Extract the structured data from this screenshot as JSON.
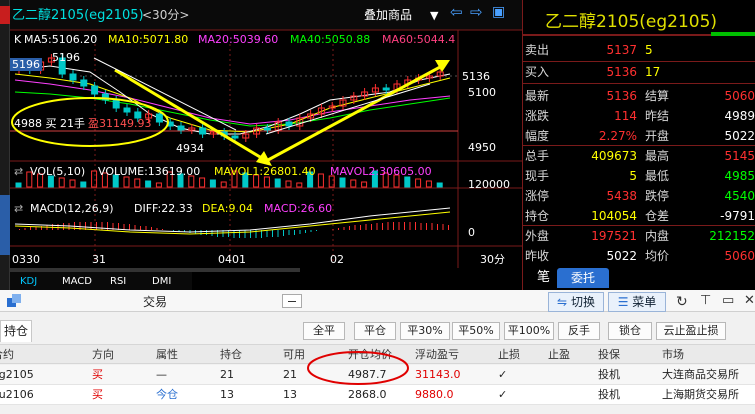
{
  "chart": {
    "title": "乙二醇2105(eg2105)",
    "period": "<30分>",
    "overlay_label": "叠加商品",
    "ma_line": {
      "k": "K",
      "ma5": "MA5:5106.20",
      "ma10": "MA10:5071.80",
      "ma20": "MA20:5039.60",
      "ma40": "MA40:5050.88",
      "ma60": "MA60:5044.4"
    },
    "price_left_label": "5196",
    "peak_label": "5196",
    "low_label": "4934",
    "annotation": "4988 买 21手",
    "annotation_profit": "盈31149.93",
    "price_axis": [
      "5136",
      "5100",
      "4950"
    ],
    "volume_line": {
      "name": "VOL(5,10)",
      "volume": "VOLUME:13619.00",
      "mavol1": "MAVOL1:26801.40",
      "mavol2": "MAVOL2:30605.00"
    },
    "volume_axis": "120000",
    "macd_line": {
      "name": "MACD(12,26,9)",
      "diff": "DIFF:22.33",
      "dea": "DEA:9.04",
      "macd": "MACD:26.60"
    },
    "macd_axis": "0",
    "time_axis": [
      "0330",
      "31",
      "0401",
      "02",
      "30分"
    ],
    "indicator_tabs": [
      "KDJ",
      "MACD",
      "RSI",
      "DMI"
    ]
  },
  "quote": {
    "title": "乙二醇2105(eg2105)",
    "ask": {
      "label": "卖出",
      "price": "5137",
      "vol": "5"
    },
    "bid": {
      "label": "买入",
      "price": "5136",
      "vol": "17"
    },
    "rows": [
      {
        "l1": "最新",
        "v1": "5136",
        "l2": "结算",
        "v2": "5060"
      },
      {
        "l1": "涨跌",
        "v1": "114",
        "l2": "昨结",
        "v2": "4989"
      },
      {
        "l1": "幅度",
        "v1": "2.27%",
        "l2": "开盘",
        "v2": "5022"
      },
      {
        "l1": "总手",
        "v1": "409673",
        "l2": "最高",
        "v2": "5145"
      },
      {
        "l1": "现手",
        "v1": "5",
        "l2": "最低",
        "v2": "4985"
      },
      {
        "l1": "涨停",
        "v1": "5438",
        "l2": "跌停",
        "v2": "4540"
      },
      {
        "l1": "持仓",
        "v1": "104054",
        "l2": "仓差",
        "v2": "-9791"
      },
      {
        "l1": "外盘",
        "v1": "197521",
        "l2": "内盘",
        "v2": "212152"
      },
      {
        "l1": "昨收",
        "v1": "5022",
        "l2": "均价",
        "v2": "5060"
      }
    ],
    "tab_bi": "笔",
    "tab_weituo": "委托"
  },
  "trade": {
    "title": "交易",
    "switch_label": "切换",
    "menu_label": "菜单",
    "positions_tab": "持仓",
    "actions": [
      "全平",
      "平仓",
      "平30%",
      "平50%",
      "平100%",
      "反手",
      "锁仓",
      "云止盈止损"
    ],
    "columns": [
      "合约",
      "方向",
      "属性",
      "持仓",
      "可用",
      "开仓均价",
      "浮动盈亏",
      "止损",
      "止盈",
      "投保",
      "市场"
    ],
    "rows": [
      {
        "contract": "eg2105",
        "dir": "买",
        "attr": "—",
        "pos": "21",
        "avail": "21",
        "avg": "4987.7",
        "pnl": "31143.0",
        "sl": "✓",
        "tp": "",
        "hedge": "投机",
        "market": "大连商品交易所"
      },
      {
        "contract": "au2106",
        "dir": "买",
        "attr": "今仓",
        "pos": "13",
        "avail": "13",
        "avg": "2868.0",
        "pnl": "9880.0",
        "sl": "✓",
        "tp": "",
        "hedge": "投机",
        "market": "上海期货交易所"
      }
    ]
  },
  "colors": {
    "up": "#ff3030",
    "down": "#00c8c8",
    "ma5": "#ffffff",
    "ma10": "#ffff00",
    "ma20": "#ff40ff",
    "ma40": "#00ff00",
    "ma60": "#ff4080",
    "annotation": "#ffff00"
  }
}
